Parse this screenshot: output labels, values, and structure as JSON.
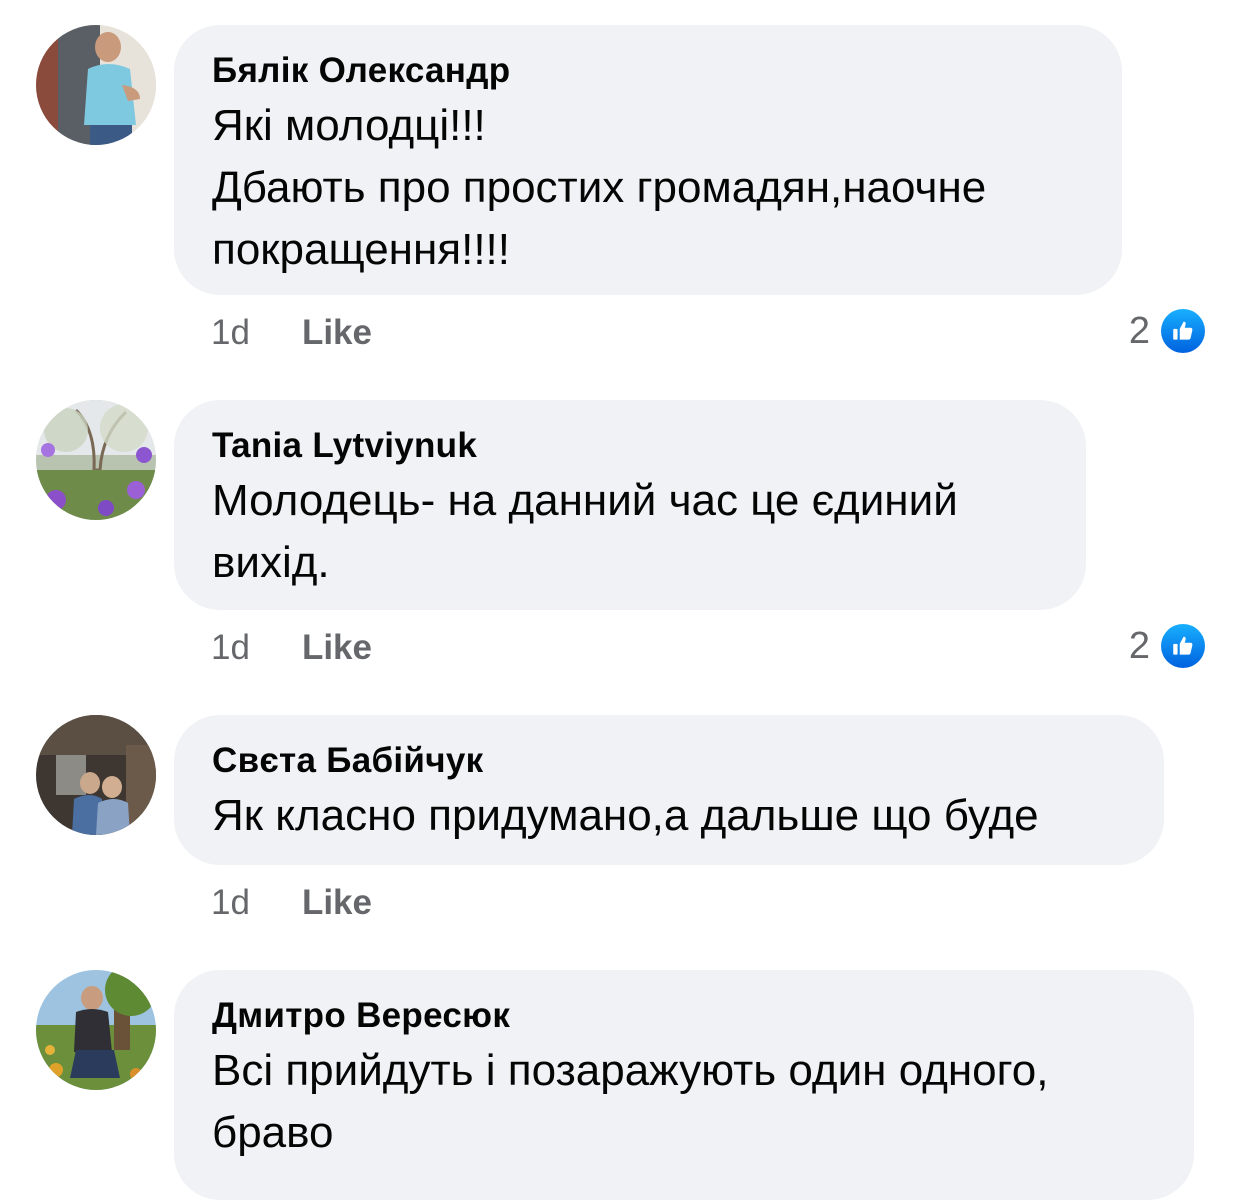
{
  "comments": [
    {
      "author": "Бялік Олександр",
      "text": "Які молодці!!!\nДбають про простих громадян,наочне покращення!!!!",
      "time": "1d",
      "like_label": "Like",
      "reaction_count": "2",
      "reaction_icon": "like-thumb-icon"
    },
    {
      "author": "Tania Lytviynuk",
      "text": "Молодець- на данний час це єдиний вихід.",
      "time": "1d",
      "like_label": "Like",
      "reaction_count": "2",
      "reaction_icon": "like-thumb-icon"
    },
    {
      "author": "Свєта Бабійчук",
      "text": "Як класно придумано,а дальше що буде",
      "time": "1d",
      "like_label": "Like"
    },
    {
      "author": "Дмитро Вересюк",
      "text": "Всі прийдуть і позаражують один одного, браво"
    }
  ],
  "colors": {
    "bubble": "#f0f2f5",
    "meta_text": "#65676b",
    "like_blue": "#1877f2"
  }
}
